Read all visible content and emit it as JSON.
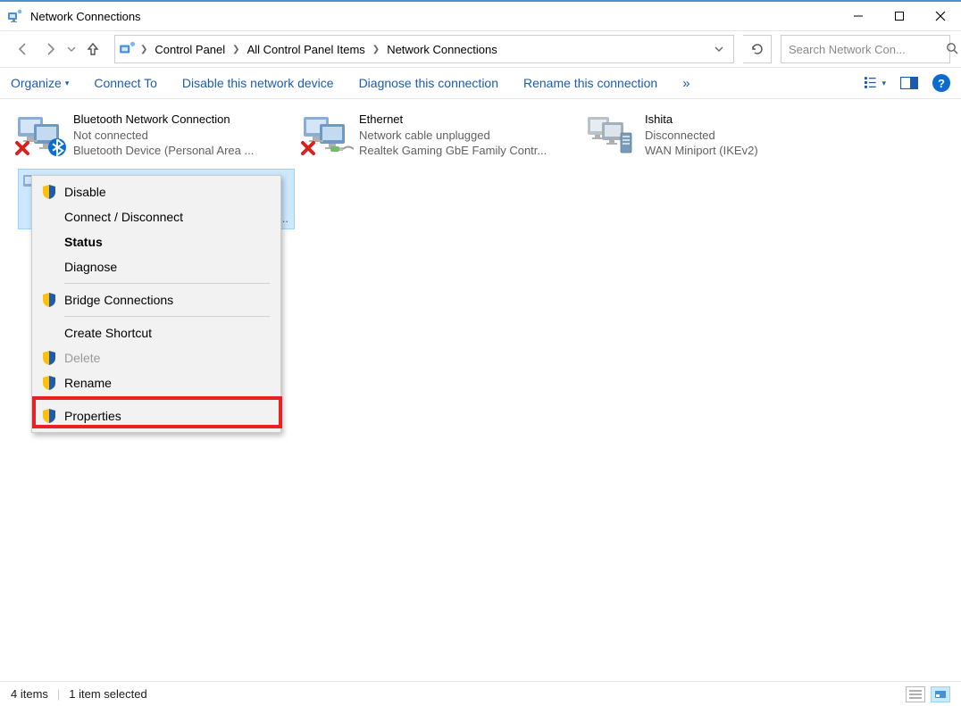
{
  "window": {
    "title": "Network Connections"
  },
  "breadcrumb": {
    "items": [
      "Control Panel",
      "All Control Panel Items",
      "Network Connections"
    ]
  },
  "search": {
    "placeholder": "Search Network Con..."
  },
  "toolbar": {
    "organize": "Organize",
    "connect_to": "Connect To",
    "disable": "Disable this network device",
    "diagnose": "Diagnose this connection",
    "rename": "Rename this connection",
    "more_chevron": "»"
  },
  "connections": [
    {
      "name": "Bluetooth Network Connection",
      "status": "Not connected",
      "device": "Bluetooth Device (Personal Area ...",
      "error": true,
      "badge": "bluetooth"
    },
    {
      "name": "Ethernet",
      "status": "Network cable unplugged",
      "device": "Realtek Gaming GbE Family Contr...",
      "error": true,
      "badge": "cable"
    },
    {
      "name": "Ishita",
      "status": "Disconnected",
      "device": "WAN Miniport (IKEv2)",
      "error": false,
      "badge": "server"
    }
  ],
  "context_menu": {
    "items": [
      {
        "label": "Disable",
        "shield": true,
        "enabled": true,
        "bold": false
      },
      {
        "label": "Connect / Disconnect",
        "shield": false,
        "enabled": true,
        "bold": false
      },
      {
        "label": "Status",
        "shield": false,
        "enabled": true,
        "bold": true
      },
      {
        "label": "Diagnose",
        "shield": false,
        "enabled": true,
        "bold": false
      },
      {
        "sep": true
      },
      {
        "label": "Bridge Connections",
        "shield": true,
        "enabled": true,
        "bold": false
      },
      {
        "sep": true
      },
      {
        "label": "Create Shortcut",
        "shield": false,
        "enabled": true,
        "bold": false
      },
      {
        "label": "Delete",
        "shield": true,
        "enabled": false,
        "bold": false
      },
      {
        "label": "Rename",
        "shield": true,
        "enabled": true,
        "bold": false
      },
      {
        "sep": true
      },
      {
        "label": "Properties",
        "shield": true,
        "enabled": true,
        "bold": false,
        "highlighted": true
      }
    ]
  },
  "statusbar": {
    "count": "4 items",
    "selection": "1 item selected"
  }
}
